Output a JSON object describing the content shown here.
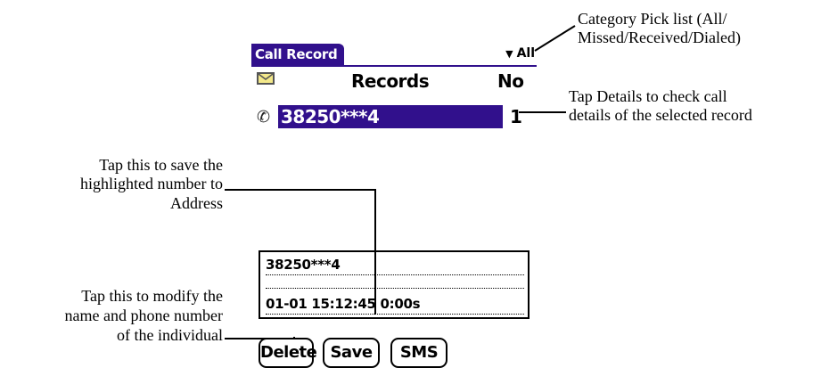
{
  "app": {
    "title": "Call Record",
    "category": "All",
    "category_arrow": "▼"
  },
  "list": {
    "header_records": "Records",
    "header_no": "No",
    "mail_icon": "mail-icon",
    "phone_icon": "phone-icon",
    "rows": [
      {
        "number": "38250***4",
        "count": "1",
        "selected": true
      }
    ]
  },
  "details": {
    "number": "38250***4",
    "name": "",
    "datetime": "01-01  15:12:45  0:00s"
  },
  "buttons": {
    "delete": "Delete",
    "save": "Save",
    "sms": "SMS"
  },
  "annotations": {
    "category_line1": "Category Pick list (All/",
    "category_line2": "Missed/Received/Dialed)",
    "details_line1": "Tap Details to check call",
    "details_line2": "details of the selected record",
    "save_line1": "Tap this to save the",
    "save_line2": "highlighted number to",
    "save_line3": "Address",
    "delete_line1": "Tap this to modify the",
    "delete_line2": "name and phone number",
    "delete_line3": "of the individual"
  },
  "colors": {
    "accent": "#31108c",
    "mail_icon_fill": "#f3e88a"
  }
}
